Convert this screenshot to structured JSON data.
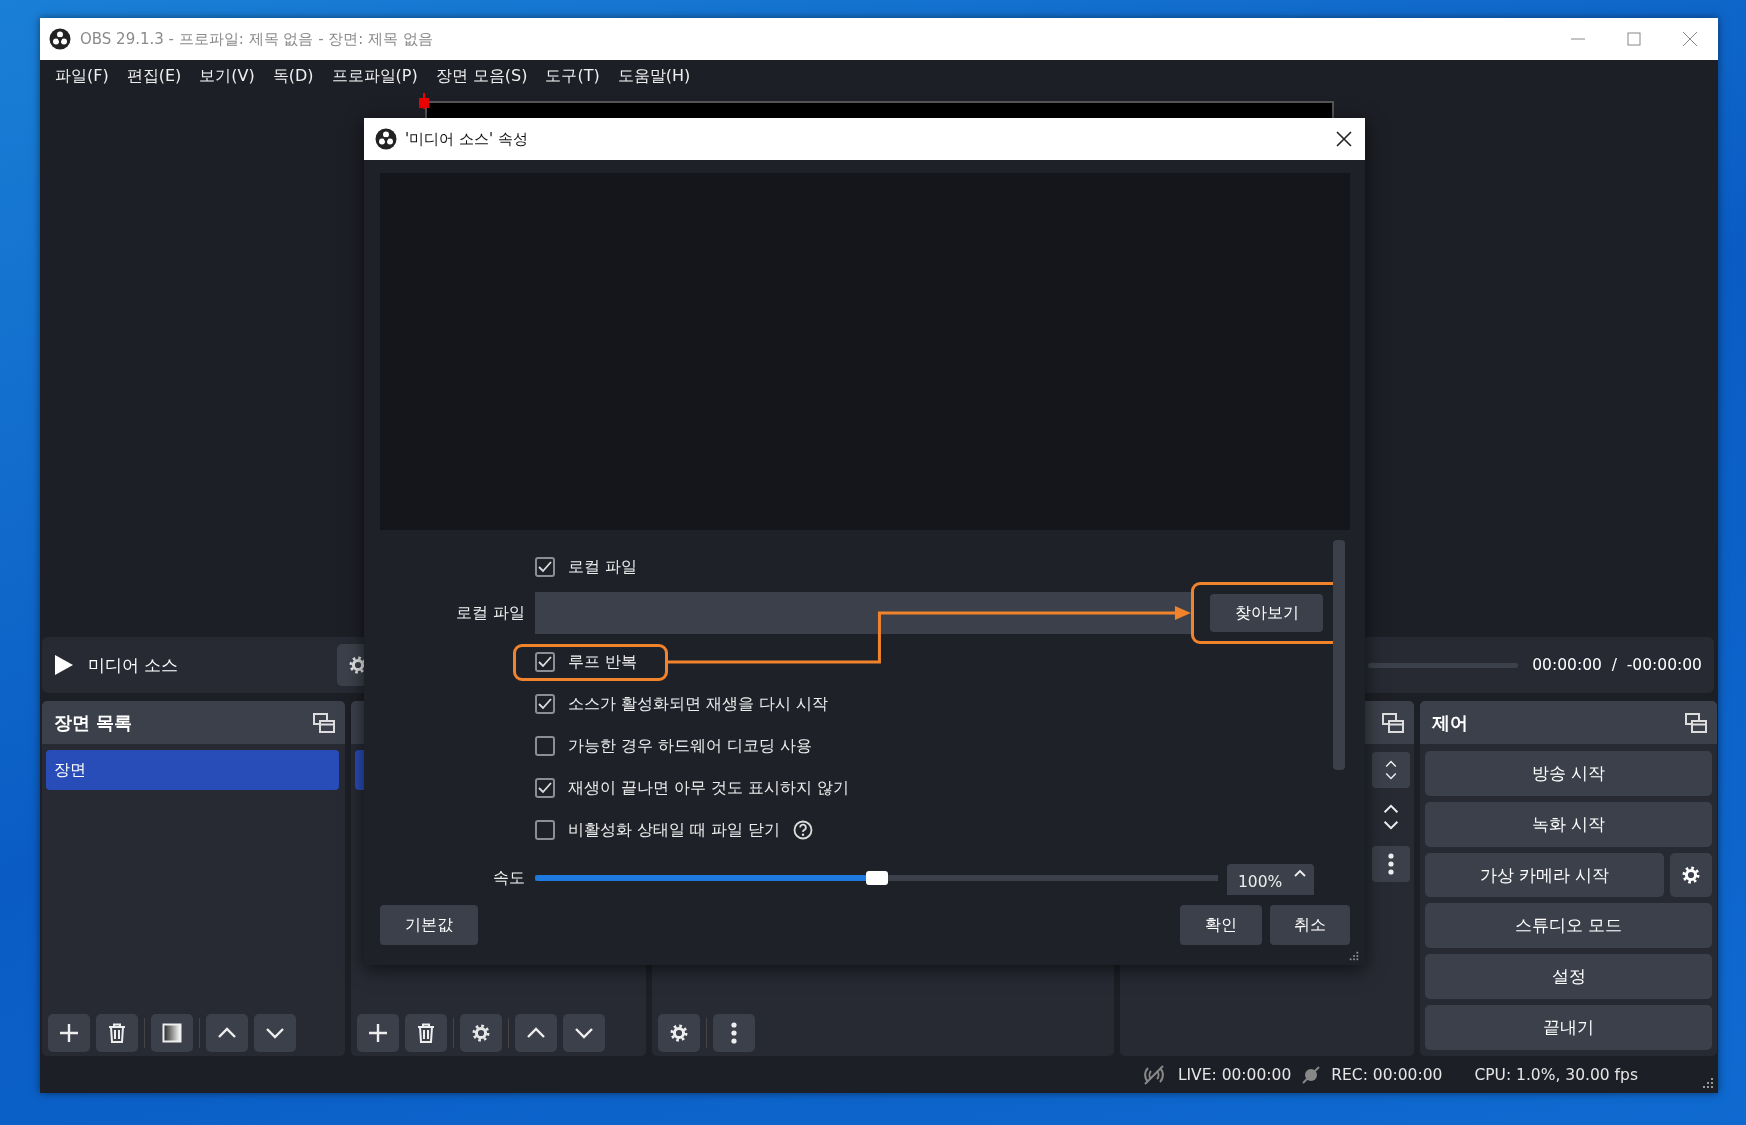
{
  "window": {
    "title": "OBS 29.1.3 - 프로파일: 제목 없음 - 장면: 제목 없음"
  },
  "menu": [
    "파일(F)",
    "편집(E)",
    "보기(V)",
    "독(D)",
    "프로파일(P)",
    "장면 모음(S)",
    "도구(T)",
    "도움말(H)"
  ],
  "media_controls": {
    "source": "미디어 소스",
    "time": "00:00:00  /  -00:00:00"
  },
  "scenes": {
    "title": "장면 목록",
    "items": [
      {
        "label": "장면",
        "selected": true
      }
    ]
  },
  "sources": {
    "items": [
      {
        "selected": true
      }
    ]
  },
  "controls": {
    "title": "제어",
    "buttons": [
      {
        "kind": "plain",
        "label": "방송 시작"
      },
      {
        "kind": "plain",
        "label": "녹화 시작"
      },
      {
        "kind": "with-settings",
        "label": "가상 카메라 시작"
      },
      {
        "kind": "plain",
        "label": "스튜디오 모드"
      },
      {
        "kind": "plain",
        "label": "설정"
      },
      {
        "kind": "plain",
        "label": "끝내기"
      }
    ]
  },
  "status_bar": {
    "live": "LIVE: 00:00:00",
    "rec": "REC: 00:00:00",
    "cpu": "CPU: 1.0%, 30.00 fps"
  },
  "dialog": {
    "title": "'미디어 소스' 속성",
    "fields": [
      {
        "kind": "checkbox",
        "label": "로컬 파일",
        "checked": true,
        "highlighted": false
      },
      {
        "kind": "file",
        "label": "로컬 파일",
        "button": "찾아보기",
        "highlighted": true
      },
      {
        "kind": "checkbox",
        "label": "루프 반복",
        "checked": true,
        "highlighted": true
      },
      {
        "kind": "checkbox",
        "label": "소스가 활성화되면 재생을 다시 시작",
        "checked": true,
        "highlighted": false
      },
      {
        "kind": "checkbox",
        "label": "가능한 경우 하드웨어 디코딩 사용",
        "checked": false,
        "highlighted": false
      },
      {
        "kind": "checkbox",
        "label": "재생이 끝나면 아무 것도 표시하지 않기",
        "checked": true,
        "highlighted": false
      },
      {
        "kind": "checkbox",
        "label": "비활성화 상태일 때 파일 닫기",
        "checked": false,
        "highlighted": false,
        "help": true
      },
      {
        "kind": "slider",
        "label": "속도",
        "level": 0.5,
        "value": "100%"
      }
    ],
    "buttons": {
      "defaults": "기본값",
      "ok": "확인",
      "cancel": "취소"
    }
  }
}
